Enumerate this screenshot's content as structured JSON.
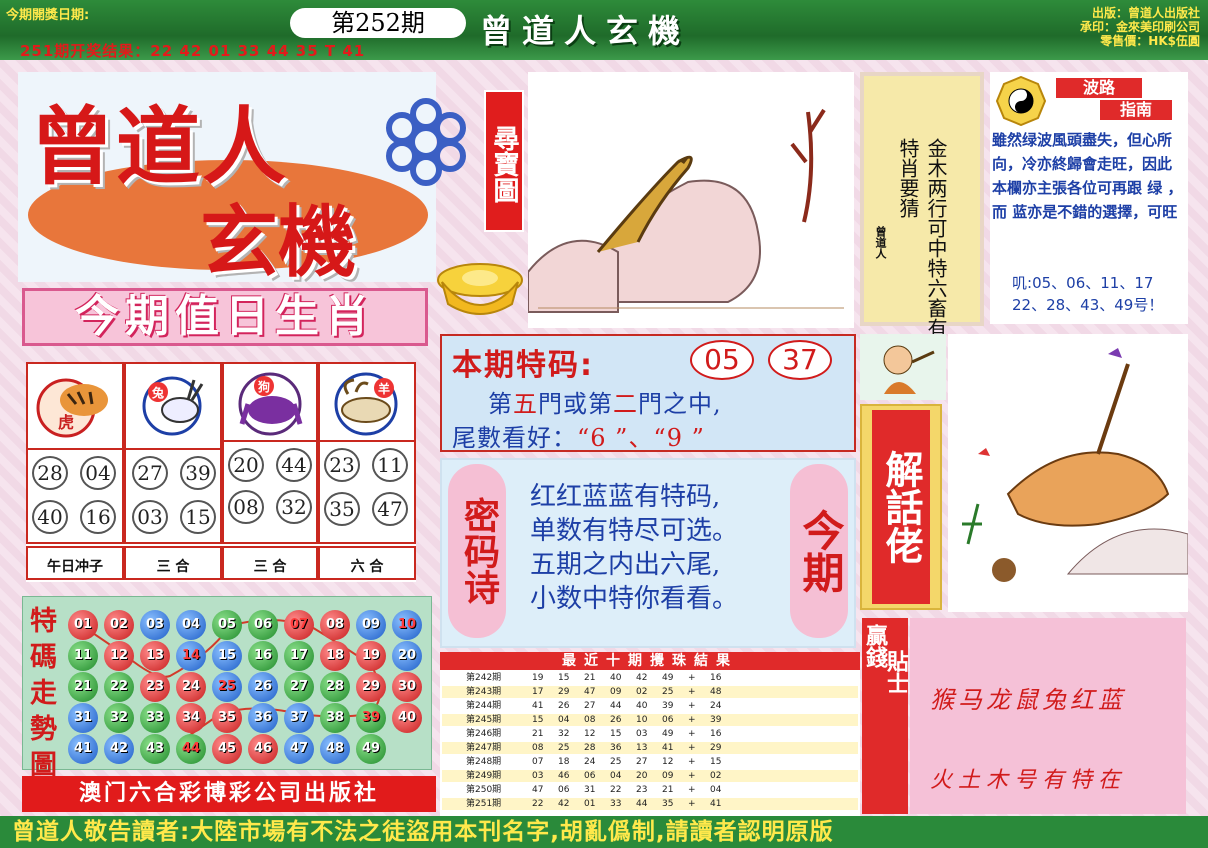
{
  "header": {
    "issue_date_label": "今期開獎日期:",
    "issue_number": "第252期",
    "last_result": "251期开奖结果：22 42 01 33 44 35 T 41",
    "title": "曾道人玄機",
    "publisher_lines": [
      "出版：曾道人出版社",
      "承印：金來美印刷公司",
      "零售價：HK$伍圓"
    ]
  },
  "logo": {
    "main": "曾道人",
    "sub": "玄機",
    "treasure_tag": "尋寶圖"
  },
  "zodiac": {
    "title": "今期值日生肖",
    "animals": [
      {
        "name": "虎",
        "numbers": [
          "28",
          "04",
          "40",
          "16"
        ],
        "label": "午日冲子"
      },
      {
        "name": "兔",
        "numbers": [
          "27",
          "39",
          "03",
          "15"
        ],
        "label": "三 合"
      },
      {
        "name": "狗",
        "numbers": [
          "20",
          "44",
          "08",
          "32"
        ],
        "label": "三 合"
      },
      {
        "name": "羊",
        "numbers": [
          "23",
          "11",
          "35",
          "47"
        ],
        "label": "六 合"
      }
    ]
  },
  "trend": {
    "title": "特碼走勢圖",
    "balls": [
      [
        "01",
        "02",
        "03",
        "04",
        "05",
        "06",
        "07",
        "08",
        "09",
        "10"
      ],
      [
        "11",
        "12",
        "13",
        "14",
        "15",
        "16",
        "17",
        "18",
        "19",
        "20"
      ],
      [
        "21",
        "22",
        "23",
        "24",
        "25",
        "26",
        "27",
        "28",
        "29",
        "30"
      ],
      [
        "31",
        "32",
        "33",
        "34",
        "35",
        "36",
        "37",
        "38",
        "39",
        "40"
      ],
      [
        "41",
        "42",
        "43",
        "44",
        "45",
        "46",
        "47",
        "48",
        "49"
      ]
    ],
    "colors": {
      "01": "red",
      "02": "red",
      "03": "blue",
      "04": "blue",
      "05": "green",
      "06": "green",
      "07": "red",
      "08": "red",
      "09": "blue",
      "10": "blue",
      "11": "green",
      "12": "red",
      "13": "red",
      "14": "blue",
      "15": "blue",
      "16": "green",
      "17": "green",
      "18": "red",
      "19": "red",
      "20": "blue",
      "21": "green",
      "22": "green",
      "23": "red",
      "24": "red",
      "25": "blue",
      "26": "blue",
      "27": "green",
      "28": "green",
      "29": "red",
      "30": "red",
      "31": "blue",
      "32": "green",
      "33": "green",
      "34": "red",
      "35": "red",
      "36": "blue",
      "37": "blue",
      "38": "green",
      "39": "green",
      "40": "red",
      "41": "blue",
      "42": "blue",
      "43": "green",
      "44": "green",
      "45": "red",
      "46": "red",
      "47": "blue",
      "48": "blue",
      "49": "green"
    },
    "highlighted": [
      "07",
      "10",
      "14",
      "25",
      "39",
      "44"
    ],
    "publisher": "澳门六合彩博彩公司出版社"
  },
  "special": {
    "title": "本期特码:",
    "codes": [
      "05",
      "37"
    ],
    "line1_a": "第",
    "line1_b": "五",
    "line1_c": "門或第",
    "line1_d": "二",
    "line1_e": "門之中,",
    "line2_a": "尾數看好：",
    "line2_b": "“6 ”、“9 ”"
  },
  "poem": {
    "tag": "密码诗",
    "this_tag": "今期",
    "lines": [
      "红红蓝蓝有特码,",
      "单数有特尽可选。",
      "五期之内出六尾,",
      "小数中特你看看。"
    ]
  },
  "history": {
    "header": "最近十期攪珠結果",
    "rows": [
      [
        "第242期",
        "19",
        "15",
        "21",
        "40",
        "42",
        "49",
        "+",
        "16"
      ],
      [
        "第243期",
        "17",
        "29",
        "47",
        "09",
        "02",
        "25",
        "+",
        "48"
      ],
      [
        "第244期",
        "41",
        "26",
        "27",
        "44",
        "40",
        "39",
        "+",
        "24"
      ],
      [
        "第245期",
        "15",
        "04",
        "08",
        "26",
        "10",
        "06",
        "+",
        "39"
      ],
      [
        "第246期",
        "21",
        "32",
        "12",
        "15",
        "03",
        "49",
        "+",
        "16"
      ],
      [
        "第247期",
        "08",
        "25",
        "28",
        "36",
        "13",
        "41",
        "+",
        "29"
      ],
      [
        "第248期",
        "07",
        "18",
        "24",
        "25",
        "27",
        "12",
        "+",
        "15"
      ],
      [
        "第249期",
        "03",
        "46",
        "06",
        "04",
        "20",
        "09",
        "+",
        "02"
      ],
      [
        "第250期",
        "47",
        "06",
        "31",
        "22",
        "23",
        "21",
        "+",
        "04"
      ],
      [
        "第251期",
        "22",
        "42",
        "01",
        "33",
        "44",
        "35",
        "+",
        "41"
      ]
    ]
  },
  "verse": {
    "text": "金木两行可中特六畜有特肖要猜",
    "signature": "曾道人"
  },
  "wave": {
    "tag1": "波路",
    "tag2": "指南",
    "text": "雖然绿波風頭盡失，但心所向，冷亦終歸會走旺，因此本欄亦主張各位可再跟 绿 ，而 蓝亦是不錯的選擇，可旺",
    "nums_lead": "叽:",
    "nums": "05、06、11、17 22、28、43、49号！"
  },
  "wise": {
    "title": "解話佬"
  },
  "tips": {
    "tag_v1": "贏錢",
    "tag_v2": "貼士",
    "line1": "猴马龙鼠兔红蓝",
    "line2": "火土木号有特在"
  },
  "bottom_banner": "曾道人敬告讀者:大陸市場有不法之徒盜用本刊名字,胡亂僞制,請讀者認明原版"
}
